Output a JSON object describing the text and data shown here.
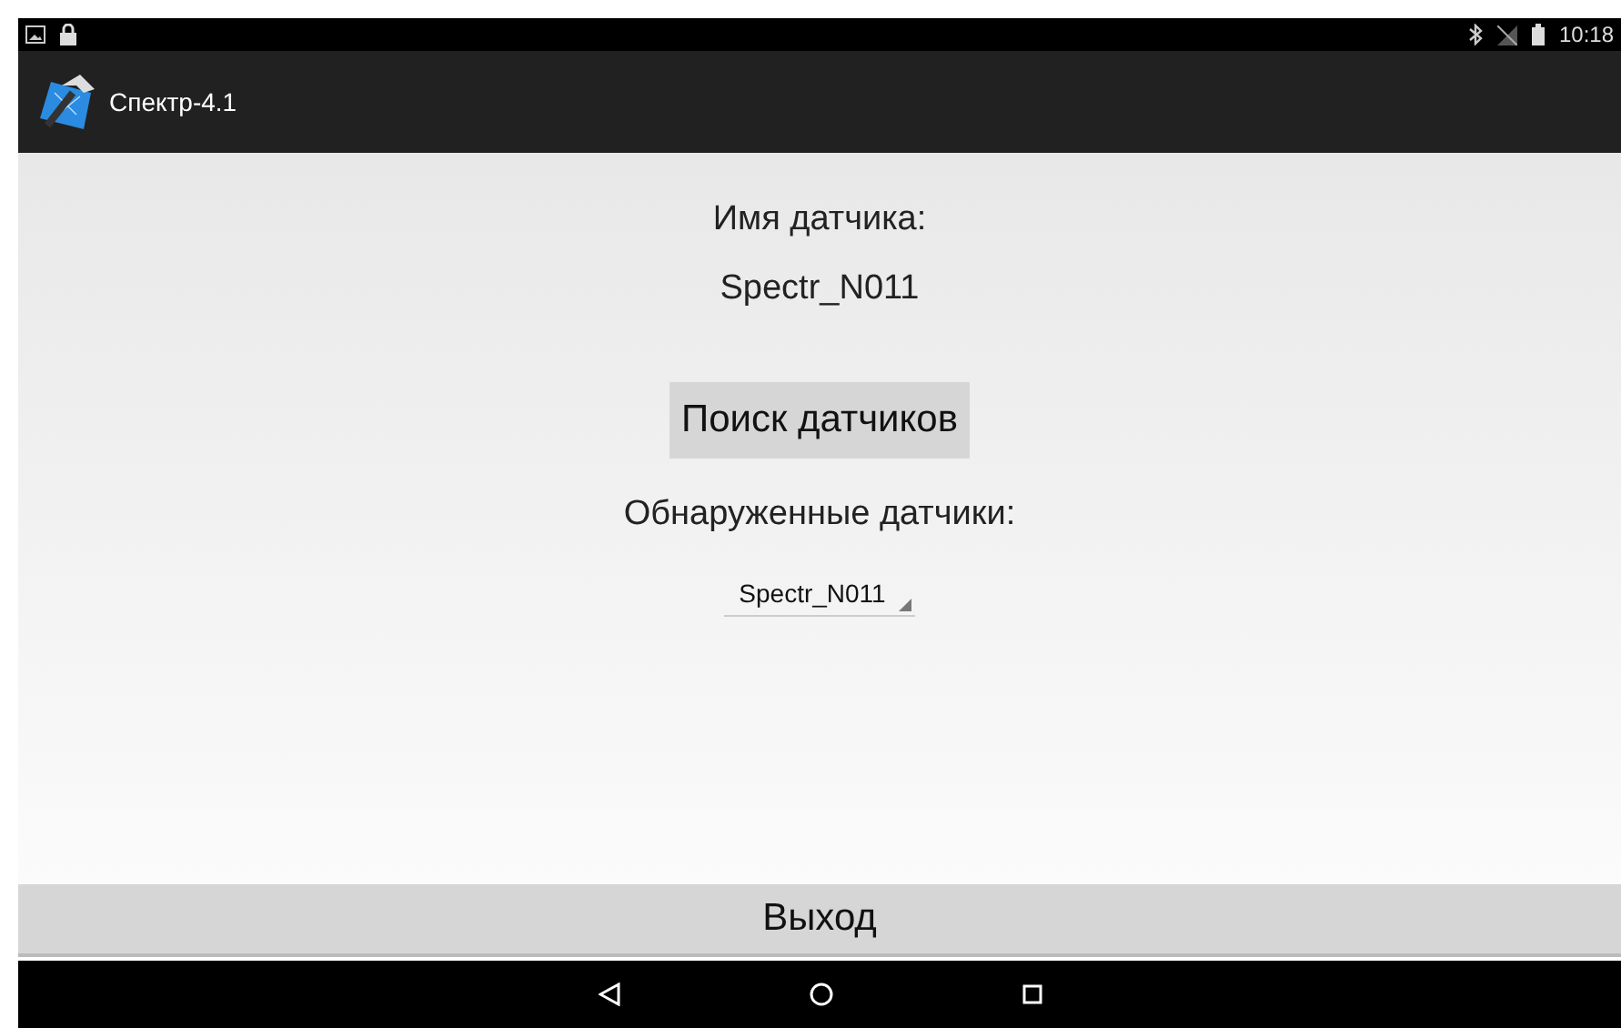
{
  "status_bar": {
    "time": "10:18"
  },
  "app_bar": {
    "title": "Спектр-4.1"
  },
  "sensor_name_label": "Имя датчика:",
  "sensor_name": "Spectr_N011",
  "search_button": "Поиск датчиков",
  "found_label": "Обнаруженные датчики:",
  "found_dropdown": {
    "value": "Spectr_N011"
  },
  "exit_button": "Выход"
}
